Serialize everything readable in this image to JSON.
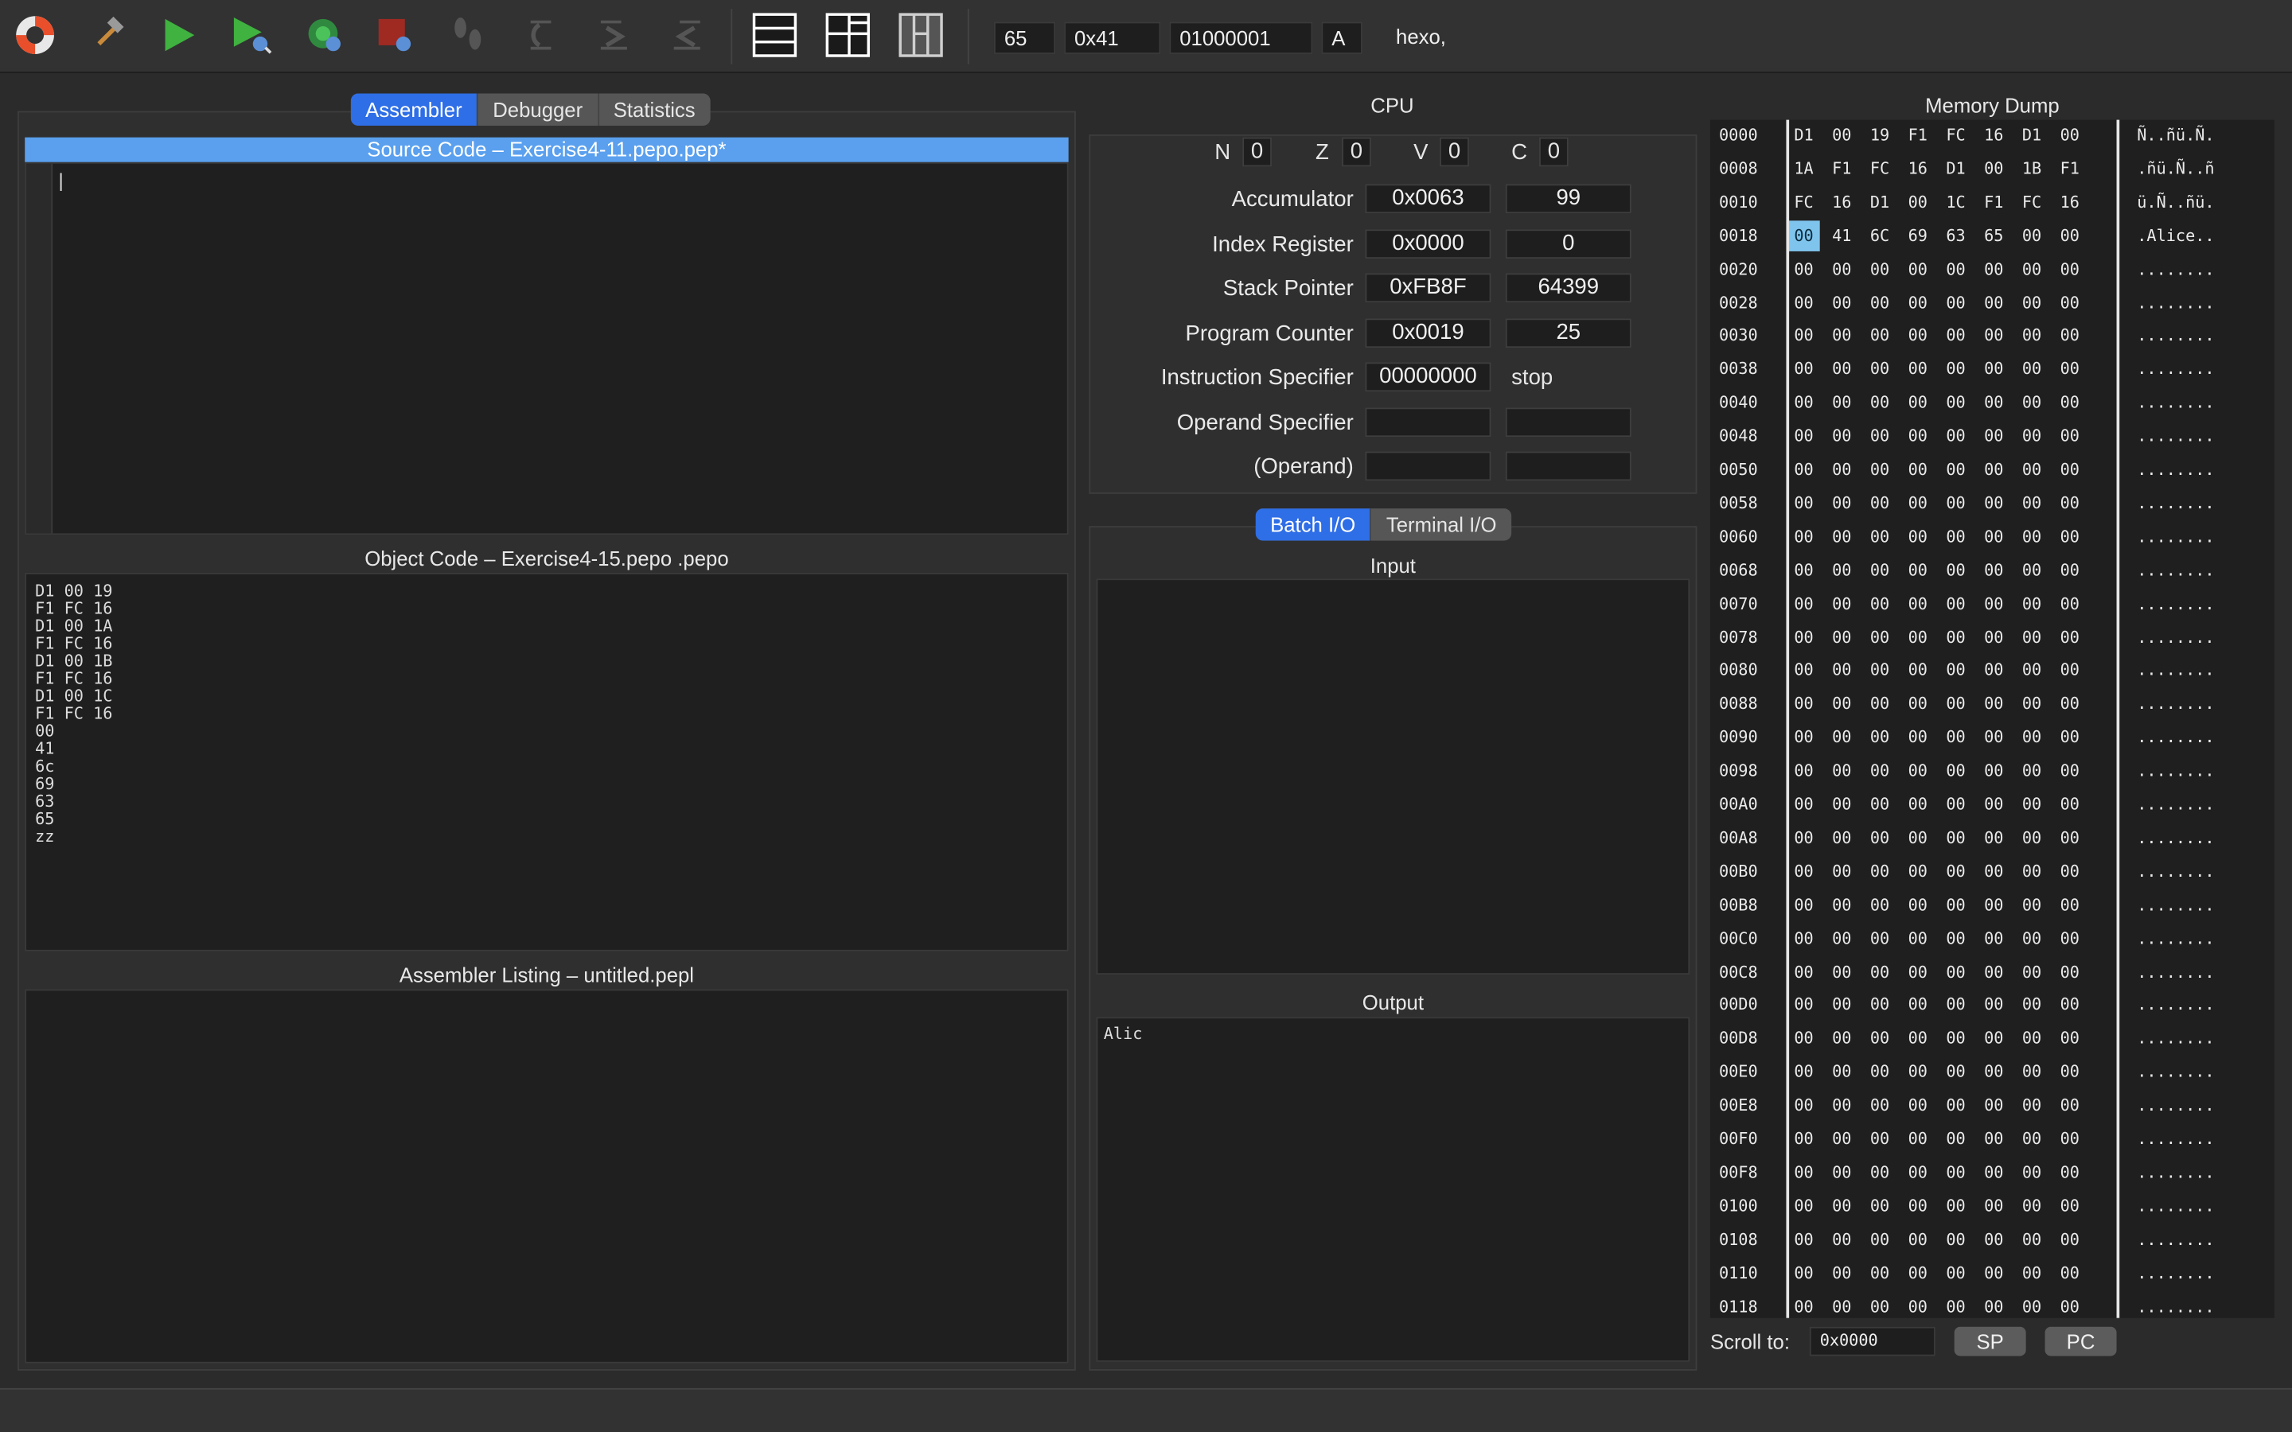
{
  "toolbar": {
    "icons": [
      "help-lifebuoy-icon",
      "build-hammer-icon",
      "run-icon",
      "run-source-icon",
      "start-debugging-icon",
      "stop-debugging-icon",
      "single-step-icon",
      "step-over-icon",
      "step-into-icon",
      "step-out-icon",
      "layout-code-only-icon",
      "layout-code-cpu-icon",
      "layout-code-trace-icon"
    ],
    "decimal_value": "65",
    "hex_value": "0x41",
    "binary_value": "01000001",
    "char_value": "A",
    "assembler_hint": "hexo,"
  },
  "left_tabs": [
    "Assembler",
    "Debugger",
    "Statistics"
  ],
  "source_pane": {
    "title": "Source Code – Exercise4-11.pepo.pep*",
    "cursor": "|"
  },
  "object_pane": {
    "title": "Object Code – Exercise4-15.pepo .pepo",
    "lines": [
      "D1 00 19",
      "F1 FC 16",
      "D1 00 1A",
      "F1 FC 16",
      "D1 00 1B",
      "F1 FC 16",
      "D1 00 1C",
      "F1 FC 16",
      "00",
      "41",
      "6c",
      "69",
      "63",
      "65",
      "zz"
    ]
  },
  "listing_pane": {
    "title": "Assembler Listing – untitled.pepl"
  },
  "cpu": {
    "title": "CPU",
    "flags": [
      {
        "name": "N",
        "value": "0"
      },
      {
        "name": "Z",
        "value": "0"
      },
      {
        "name": "V",
        "value": "0"
      },
      {
        "name": "C",
        "value": "0"
      }
    ],
    "registers": [
      {
        "label": "Accumulator",
        "hex": "0x0063",
        "dec": "99"
      },
      {
        "label": "Index Register",
        "hex": "0x0000",
        "dec": "0"
      },
      {
        "label": "Stack Pointer",
        "hex": "0xFB8F",
        "dec": "64399"
      },
      {
        "label": "Program Counter",
        "hex": "0x0019",
        "dec": "25"
      },
      {
        "label": "Instruction Specifier",
        "hex": "00000000",
        "dec": "stop"
      },
      {
        "label": "Operand Specifier",
        "hex": "",
        "dec": ""
      },
      {
        "label": "(Operand)",
        "hex": "",
        "dec": ""
      }
    ]
  },
  "io": {
    "tabs": [
      "Batch I/O",
      "Terminal I/O"
    ],
    "input_title": "Input",
    "output_title": "Output",
    "output_text": "Alic"
  },
  "memory": {
    "title": "Memory Dump",
    "rows": [
      {
        "addr": "0000",
        "bytes": [
          "D1",
          "00",
          "19",
          "F1",
          "FC",
          "16",
          "D1",
          "00"
        ],
        "ascii": "Ñ..ñü.Ñ."
      },
      {
        "addr": "0008",
        "bytes": [
          "1A",
          "F1",
          "FC",
          "16",
          "D1",
          "00",
          "1B",
          "F1"
        ],
        "ascii": ".ñü.Ñ..ñ"
      },
      {
        "addr": "0010",
        "bytes": [
          "FC",
          "16",
          "D1",
          "00",
          "1C",
          "F1",
          "FC",
          "16"
        ],
        "ascii": "ü.Ñ..ñü."
      },
      {
        "addr": "0018",
        "bytes": [
          "00",
          "41",
          "6C",
          "69",
          "63",
          "65",
          "00",
          "00"
        ],
        "ascii": ".Alice.."
      },
      {
        "addr": "0020",
        "bytes": [
          "00",
          "00",
          "00",
          "00",
          "00",
          "00",
          "00",
          "00"
        ],
        "ascii": "........"
      },
      {
        "addr": "0028",
        "bytes": [
          "00",
          "00",
          "00",
          "00",
          "00",
          "00",
          "00",
          "00"
        ],
        "ascii": "........"
      },
      {
        "addr": "0030",
        "bytes": [
          "00",
          "00",
          "00",
          "00",
          "00",
          "00",
          "00",
          "00"
        ],
        "ascii": "........"
      },
      {
        "addr": "0038",
        "bytes": [
          "00",
          "00",
          "00",
          "00",
          "00",
          "00",
          "00",
          "00"
        ],
        "ascii": "........"
      },
      {
        "addr": "0040",
        "bytes": [
          "00",
          "00",
          "00",
          "00",
          "00",
          "00",
          "00",
          "00"
        ],
        "ascii": "........"
      },
      {
        "addr": "0048",
        "bytes": [
          "00",
          "00",
          "00",
          "00",
          "00",
          "00",
          "00",
          "00"
        ],
        "ascii": "........"
      },
      {
        "addr": "0050",
        "bytes": [
          "00",
          "00",
          "00",
          "00",
          "00",
          "00",
          "00",
          "00"
        ],
        "ascii": "........"
      },
      {
        "addr": "0058",
        "bytes": [
          "00",
          "00",
          "00",
          "00",
          "00",
          "00",
          "00",
          "00"
        ],
        "ascii": "........"
      },
      {
        "addr": "0060",
        "bytes": [
          "00",
          "00",
          "00",
          "00",
          "00",
          "00",
          "00",
          "00"
        ],
        "ascii": "........"
      },
      {
        "addr": "0068",
        "bytes": [
          "00",
          "00",
          "00",
          "00",
          "00",
          "00",
          "00",
          "00"
        ],
        "ascii": "........"
      },
      {
        "addr": "0070",
        "bytes": [
          "00",
          "00",
          "00",
          "00",
          "00",
          "00",
          "00",
          "00"
        ],
        "ascii": "........"
      },
      {
        "addr": "0078",
        "bytes": [
          "00",
          "00",
          "00",
          "00",
          "00",
          "00",
          "00",
          "00"
        ],
        "ascii": "........"
      },
      {
        "addr": "0080",
        "bytes": [
          "00",
          "00",
          "00",
          "00",
          "00",
          "00",
          "00",
          "00"
        ],
        "ascii": "........"
      },
      {
        "addr": "0088",
        "bytes": [
          "00",
          "00",
          "00",
          "00",
          "00",
          "00",
          "00",
          "00"
        ],
        "ascii": "........"
      },
      {
        "addr": "0090",
        "bytes": [
          "00",
          "00",
          "00",
          "00",
          "00",
          "00",
          "00",
          "00"
        ],
        "ascii": "........"
      },
      {
        "addr": "0098",
        "bytes": [
          "00",
          "00",
          "00",
          "00",
          "00",
          "00",
          "00",
          "00"
        ],
        "ascii": "........"
      },
      {
        "addr": "00A0",
        "bytes": [
          "00",
          "00",
          "00",
          "00",
          "00",
          "00",
          "00",
          "00"
        ],
        "ascii": "........"
      },
      {
        "addr": "00A8",
        "bytes": [
          "00",
          "00",
          "00",
          "00",
          "00",
          "00",
          "00",
          "00"
        ],
        "ascii": "........"
      },
      {
        "addr": "00B0",
        "bytes": [
          "00",
          "00",
          "00",
          "00",
          "00",
          "00",
          "00",
          "00"
        ],
        "ascii": "........"
      },
      {
        "addr": "00B8",
        "bytes": [
          "00",
          "00",
          "00",
          "00",
          "00",
          "00",
          "00",
          "00"
        ],
        "ascii": "........"
      },
      {
        "addr": "00C0",
        "bytes": [
          "00",
          "00",
          "00",
          "00",
          "00",
          "00",
          "00",
          "00"
        ],
        "ascii": "........"
      },
      {
        "addr": "00C8",
        "bytes": [
          "00",
          "00",
          "00",
          "00",
          "00",
          "00",
          "00",
          "00"
        ],
        "ascii": "........"
      },
      {
        "addr": "00D0",
        "bytes": [
          "00",
          "00",
          "00",
          "00",
          "00",
          "00",
          "00",
          "00"
        ],
        "ascii": "........"
      },
      {
        "addr": "00D8",
        "bytes": [
          "00",
          "00",
          "00",
          "00",
          "00",
          "00",
          "00",
          "00"
        ],
        "ascii": "........"
      },
      {
        "addr": "00E0",
        "bytes": [
          "00",
          "00",
          "00",
          "00",
          "00",
          "00",
          "00",
          "00"
        ],
        "ascii": "........"
      },
      {
        "addr": "00E8",
        "bytes": [
          "00",
          "00",
          "00",
          "00",
          "00",
          "00",
          "00",
          "00"
        ],
        "ascii": "........"
      },
      {
        "addr": "00F0",
        "bytes": [
          "00",
          "00",
          "00",
          "00",
          "00",
          "00",
          "00",
          "00"
        ],
        "ascii": "........"
      },
      {
        "addr": "00F8",
        "bytes": [
          "00",
          "00",
          "00",
          "00",
          "00",
          "00",
          "00",
          "00"
        ],
        "ascii": "........"
      },
      {
        "addr": "0100",
        "bytes": [
          "00",
          "00",
          "00",
          "00",
          "00",
          "00",
          "00",
          "00"
        ],
        "ascii": "........"
      },
      {
        "addr": "0108",
        "bytes": [
          "00",
          "00",
          "00",
          "00",
          "00",
          "00",
          "00",
          "00"
        ],
        "ascii": "........"
      },
      {
        "addr": "0110",
        "bytes": [
          "00",
          "00",
          "00",
          "00",
          "00",
          "00",
          "00",
          "00"
        ],
        "ascii": "........"
      },
      {
        "addr": "0118",
        "bytes": [
          "00",
          "00",
          "00",
          "00",
          "00",
          "00",
          "00",
          "00"
        ],
        "ascii": "........"
      }
    ],
    "highlight": {
      "row": 3,
      "col": 0,
      "color": "#7fc4ec"
    },
    "scroll_label": "Scroll to:",
    "scroll_value": "0x0000",
    "sp_button": "SP",
    "pc_button": "PC"
  },
  "colors": {
    "accent": "#2e6ee6",
    "source_title_bg": "#5aa0ee",
    "run_green": "#3fb23f",
    "debug_stop_red": "#c0392b"
  }
}
